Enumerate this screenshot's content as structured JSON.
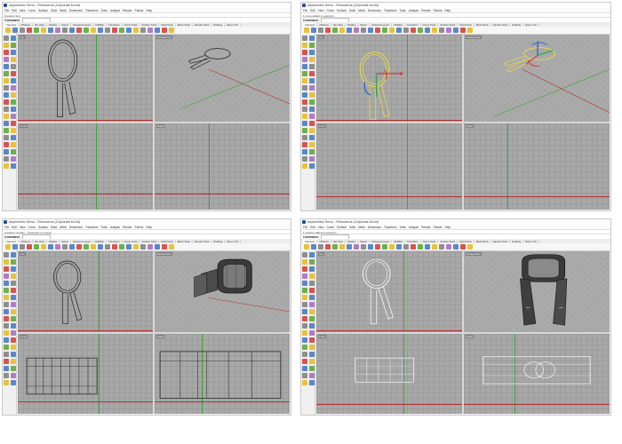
{
  "panels": [
    {
      "id": "tl",
      "title": "Asymmetric Servo - Rhinoceros (Corporate 64-bit)",
      "history": "Creating Text",
      "command_label": "Command:",
      "views": [
        "Top",
        "Perspective",
        "Front",
        "Right"
      ]
    },
    {
      "id": "tr",
      "title": "Asymmetric Servo - Rhinoceros (Corporate 64-bit)",
      "history": "1 curve added to selection",
      "command_label": "Command:",
      "views": [
        "Top",
        "Perspective",
        "Front",
        "Right"
      ]
    },
    {
      "id": "bl",
      "title": "Asymmetric Servo - Rhinoceros (Corporate 64-bit)",
      "history": "Creating meshes... Press Esc to cancel",
      "command_label": "Command:",
      "views": [
        "Top",
        "Perspective",
        "Front",
        "Right"
      ]
    },
    {
      "id": "br",
      "title": "Asymmetric Servo - Rhinoceros (Corporate 64-bit)",
      "history": "1 surface added to selection",
      "command_label": "Command:",
      "views": [
        "Top",
        "Perspective",
        "Front",
        "Right"
      ]
    }
  ],
  "menu": [
    "File",
    "Edit",
    "View",
    "Curve",
    "Surface",
    "Solid",
    "Mesh",
    "Dimension",
    "Transform",
    "Tools",
    "Analyze",
    "Render",
    "Panels",
    "Help"
  ],
  "tabs": [
    "Standard",
    "CPlanes",
    "Set View",
    "Display",
    "Select",
    "Viewport Layout",
    "Visibility",
    "Transform",
    "Curve Tools",
    "Surface Tools",
    "Solid Tools",
    "Mesh Tools",
    "Render Tools",
    "Drafting",
    "New in V6"
  ],
  "toolbar_colors": [
    "#e8c23a",
    "#5a87c9",
    "#8e8e8e",
    "#d9534f",
    "#6fb04a",
    "#e8c23a",
    "#5a87c9",
    "#b07cc6",
    "#8e8e8e",
    "#5a87c9",
    "#d9534f",
    "#6fb04a",
    "#e8c23a",
    "#5a87c9",
    "#8e8e8e",
    "#d9534f",
    "#6fb04a",
    "#5a87c9",
    "#e8c23a",
    "#8e8e8e",
    "#b07cc6",
    "#5a87c9",
    "#d9534f",
    "#e8c23a"
  ],
  "lefttool_colors": [
    "#8e8e8e",
    "#5a87c9",
    "#e8c23a",
    "#6fb04a",
    "#d9534f",
    "#5a87c9",
    "#b07cc6",
    "#e8c23a",
    "#5a87c9",
    "#8e8e8e",
    "#6fb04a",
    "#d9534f",
    "#e8c23a",
    "#5a87c9",
    "#8e8e8e",
    "#b07cc6",
    "#5a87c9",
    "#e8c23a",
    "#d9534f",
    "#6fb04a",
    "#8e8e8e",
    "#5a87c9",
    "#e8c23a",
    "#b07cc6",
    "#5a87c9",
    "#d9534f",
    "#6fb04a",
    "#e8c23a",
    "#8e8e8e",
    "#5a87c9",
    "#d9534f",
    "#e8c23a",
    "#5a87c9",
    "#6fb04a",
    "#8e8e8e",
    "#b07cc6",
    "#e8c23a",
    "#5a87c9"
  ]
}
